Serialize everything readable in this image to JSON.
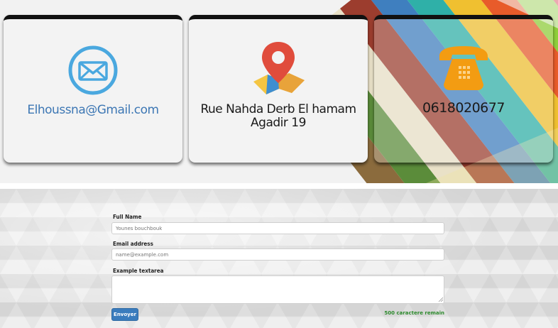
{
  "contact": {
    "email": "Elhoussna@Gmail.com",
    "address_line1": "Rue Nahda Derb El hamam",
    "address_line2": "Agadir 19",
    "phone": "0618020677"
  },
  "form": {
    "full_name_label": "Full Name",
    "full_name_placeholder": "Younes bouchbouk",
    "email_label": "Email address",
    "email_placeholder": "name@example.com",
    "textarea_label": "Example textarea",
    "submit_label": "Envoyer",
    "char_counter": "500 caractere remain"
  },
  "icons": {
    "email": "envelope-icon",
    "address": "map-pin-icon",
    "phone": "telephone-icon"
  },
  "colors": {
    "email_text": "#3d77b4",
    "envelope": "#4aa8df",
    "map_pin": "#e04c3c",
    "phone": "#f39c12",
    "button": "#3a7cbd",
    "counter": "#2d8a2d"
  }
}
